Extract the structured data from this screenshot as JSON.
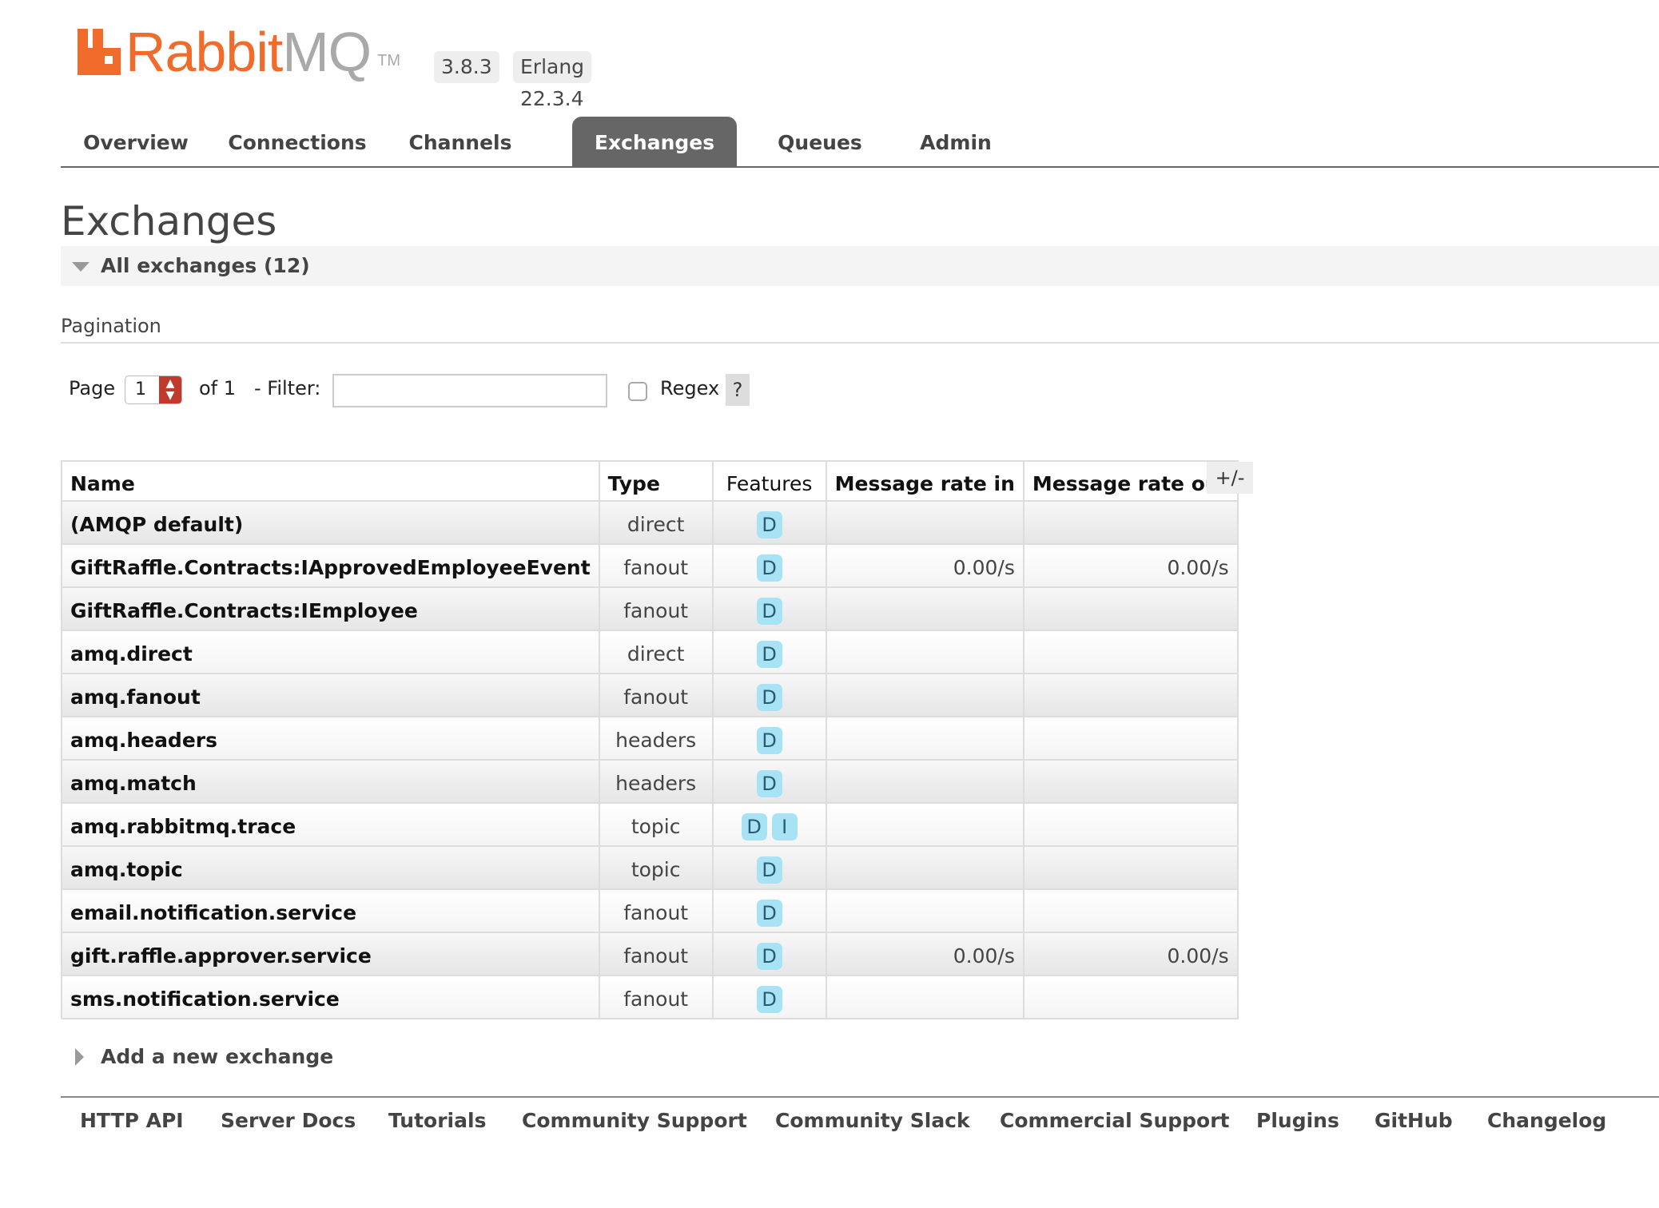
{
  "brand": {
    "name_part1": "Rabbit",
    "name_part2": "MQ",
    "trademark": "TM",
    "version": "3.8.3",
    "erlang": "Erlang 22.3.4",
    "accent_color": "#f16b2b"
  },
  "nav": {
    "tabs": [
      {
        "label": "Overview",
        "active": false
      },
      {
        "label": "Connections",
        "active": false
      },
      {
        "label": "Channels",
        "active": false
      },
      {
        "label": "Exchanges",
        "active": true
      },
      {
        "label": "Queues",
        "active": false
      },
      {
        "label": "Admin",
        "active": false
      }
    ]
  },
  "page": {
    "title": "Exchanges",
    "section_label": "All exchanges (12)"
  },
  "pagination": {
    "heading": "Pagination",
    "page_label": "Page",
    "page_value": "1",
    "of_label": "of 1",
    "filter_label": "- Filter:",
    "filter_value": "",
    "regex_label": "Regex",
    "regex_checked": false,
    "help_label": "?"
  },
  "table": {
    "columns": {
      "name": "Name",
      "type": "Type",
      "features": "Features",
      "rate_in": "Message rate in",
      "rate_out": "Message rate out"
    },
    "toggle_columns": "+/-",
    "rows": [
      {
        "name": "(AMQP default)",
        "type": "direct",
        "features": [
          "D"
        ],
        "rate_in": "",
        "rate_out": ""
      },
      {
        "name": "GiftRaffle.Contracts:IApprovedEmployeeEvent",
        "type": "fanout",
        "features": [
          "D"
        ],
        "rate_in": "0.00/s",
        "rate_out": "0.00/s"
      },
      {
        "name": "GiftRaffle.Contracts:IEmployee",
        "type": "fanout",
        "features": [
          "D"
        ],
        "rate_in": "",
        "rate_out": ""
      },
      {
        "name": "amq.direct",
        "type": "direct",
        "features": [
          "D"
        ],
        "rate_in": "",
        "rate_out": ""
      },
      {
        "name": "amq.fanout",
        "type": "fanout",
        "features": [
          "D"
        ],
        "rate_in": "",
        "rate_out": ""
      },
      {
        "name": "amq.headers",
        "type": "headers",
        "features": [
          "D"
        ],
        "rate_in": "",
        "rate_out": ""
      },
      {
        "name": "amq.match",
        "type": "headers",
        "features": [
          "D"
        ],
        "rate_in": "",
        "rate_out": ""
      },
      {
        "name": "amq.rabbitmq.trace",
        "type": "topic",
        "features": [
          "D",
          "I"
        ],
        "rate_in": "",
        "rate_out": ""
      },
      {
        "name": "amq.topic",
        "type": "topic",
        "features": [
          "D"
        ],
        "rate_in": "",
        "rate_out": ""
      },
      {
        "name": "email.notification.service",
        "type": "fanout",
        "features": [
          "D"
        ],
        "rate_in": "",
        "rate_out": ""
      },
      {
        "name": "gift.raffle.approver.service",
        "type": "fanout",
        "features": [
          "D"
        ],
        "rate_in": "0.00/s",
        "rate_out": "0.00/s"
      },
      {
        "name": "sms.notification.service",
        "type": "fanout",
        "features": [
          "D"
        ],
        "rate_in": "",
        "rate_out": ""
      }
    ]
  },
  "add_exchange_label": "Add a new exchange",
  "footer": {
    "links": [
      "HTTP API",
      "Server Docs",
      "Tutorials",
      "Community Support",
      "Community Slack",
      "Commercial Support",
      "Plugins",
      "GitHub",
      "Changelog"
    ]
  }
}
